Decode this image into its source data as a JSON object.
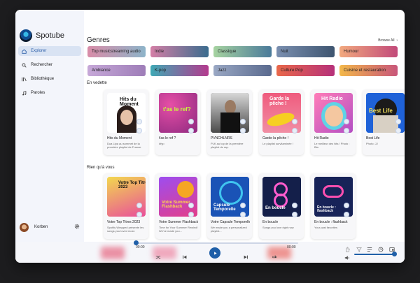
{
  "app": {
    "name": "Spotube"
  },
  "sidebar": {
    "items": [
      {
        "label": "Explorer",
        "icon": "home-icon",
        "active": true
      },
      {
        "label": "Rechercher",
        "icon": "search-icon",
        "active": false
      },
      {
        "label": "Bibliothèque",
        "icon": "library-icon",
        "active": false
      },
      {
        "label": "Paroles",
        "icon": "music-note-icon",
        "active": false
      }
    ],
    "user": {
      "name": "Korben"
    }
  },
  "genres": {
    "title": "Genres",
    "browse_all": "Browse All",
    "items": [
      {
        "label": "Top musicstreaming audio",
        "colors": [
          "#d98ca8",
          "#8db4c9"
        ]
      },
      {
        "label": "Indie",
        "colors": [
          "#d47fa6",
          "#3a6c8e"
        ]
      },
      {
        "label": "Classique",
        "colors": [
          "#a6d3a0",
          "#4a7a9a"
        ]
      },
      {
        "label": "Nuit",
        "colors": [
          "#7a8fb0",
          "#3e5570"
        ]
      },
      {
        "label": "Humour",
        "colors": [
          "#f2a97e",
          "#c24a7a"
        ]
      },
      {
        "label": "Ambiance",
        "colors": [
          "#c6a8d8",
          "#9e7db8"
        ]
      },
      {
        "label": "K-pop",
        "colors": [
          "#3fa9b5",
          "#b43a8e"
        ]
      },
      {
        "label": "Jazz",
        "colors": [
          "#9aa8c4",
          "#5a6a8e"
        ]
      },
      {
        "label": "Culture Pop",
        "colors": [
          "#e9684a",
          "#b6317a"
        ]
      },
      {
        "label": "Cuisine et restauration",
        "colors": [
          "#f3b84a",
          "#c8567a"
        ]
      }
    ]
  },
  "featured": {
    "title": "En vedette",
    "cards": [
      {
        "title": "Hits du Moment",
        "subtitle": "Dua Lipa au sommet de la première playlist de France.",
        "cover_text": "Hits du Moment",
        "cover_bg": "#ffffff",
        "cover_fg": "#111111"
      },
      {
        "title": "t'as le ref ?",
        "subtitle": "#fyp",
        "cover_text": "t'as le ref?",
        "cover_bg": "#c0318a",
        "cover_fg": "#c9ff3a"
      },
      {
        "title": "PVNCHLNRS",
        "subtitle": "PLK au top de la première playlist de rap.",
        "cover_text": "",
        "cover_bg": "#3a3a3a",
        "cover_fg": "#ffffff"
      },
      {
        "title": "Garde la pêche !",
        "subtitle": "Le playlist survitaminée !",
        "cover_text": "Garde la pêche !",
        "cover_bg": "#e7507a",
        "cover_fg": "#ffffff"
      },
      {
        "title": "Hit Radio",
        "subtitle": "Le meilleur des hits ! Photo : Bia",
        "cover_text": "Hit Radio",
        "cover_bg": "#e96aa5",
        "cover_fg": "#ffffff"
      },
      {
        "title": "Best Life",
        "subtitle": "Photo: JJ",
        "cover_text": "Best Life",
        "cover_bg": "#2a6cd8",
        "cover_fg": "#f7e35a"
      }
    ]
  },
  "for_you": {
    "title": "Rien qu'à vous",
    "cards": [
      {
        "title": "Votre Top Titres 2023",
        "subtitle": "Spotify Wrapped présente les songs you loved most.",
        "cover_text": "Votre Top Titres 2023",
        "cover_bg": "#f1d24a",
        "cover_fg": "#111111"
      },
      {
        "title": "Votre Summer Flashback",
        "subtitle": "Time for Your Summer Rewind! We've made you...",
        "cover_text": "Votre Summer Flashback",
        "cover_bg": "#8a3fe0",
        "cover_fg": "#ffd64a"
      },
      {
        "title": "Votre Capsule Temporelle",
        "subtitle": "We made you a personalized playlist...",
        "cover_text": "Capsule Temporelle",
        "cover_bg": "#1b4fa8",
        "cover_fg": "#ffffff"
      },
      {
        "title": "En boucle",
        "subtitle": "Songs you love right now",
        "cover_text": "En boucle",
        "cover_bg": "#1c2a5c",
        "cover_fg": "#ffffff"
      },
      {
        "title": "En boucle : flashback",
        "subtitle": "Your past favorites",
        "cover_text": "En boucle : flashback",
        "cover_bg": "#1e2a64",
        "cover_fg": "#ffffff"
      }
    ]
  },
  "player": {
    "time_current": "00:00",
    "time_total": "00:00",
    "progress": 0,
    "volume": 0.95
  },
  "colors": {
    "accent": "#1f5fa8",
    "sidebar_bg": "#f3f5fb"
  }
}
